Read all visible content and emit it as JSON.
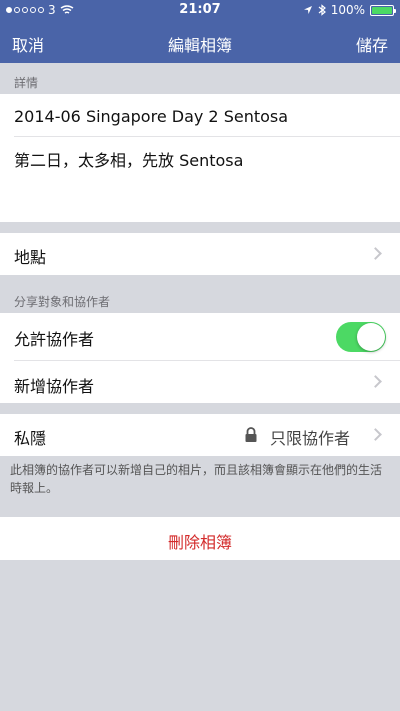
{
  "status": {
    "carrier_signal": "3",
    "time": "21:07",
    "battery": "100%"
  },
  "nav": {
    "cancel": "取消",
    "title": "編輯相簿",
    "save": "儲存"
  },
  "details": {
    "section_label": "詳情",
    "album_name": "2014-06 Singapore Day 2 Sentosa",
    "description": "第二日，太多相，先放 Sentosa"
  },
  "location": {
    "label": "地點"
  },
  "share": {
    "section_label": "分享對象和協作者",
    "allow_contributors": "允許協作者",
    "add_contributors": "新增協作者",
    "allow_on": true
  },
  "privacy": {
    "label": "私隱",
    "value": "只限協作者",
    "footnote": "此相簿的協作者可以新增自己的相片，而且該相簿會顯示在他們的生活時報上。"
  },
  "delete": {
    "label": "刪除相簿"
  },
  "colors": {
    "nav_bg": "#4a64a8",
    "toggle_on": "#4cd964",
    "delete_red": "#d32a2a"
  }
}
